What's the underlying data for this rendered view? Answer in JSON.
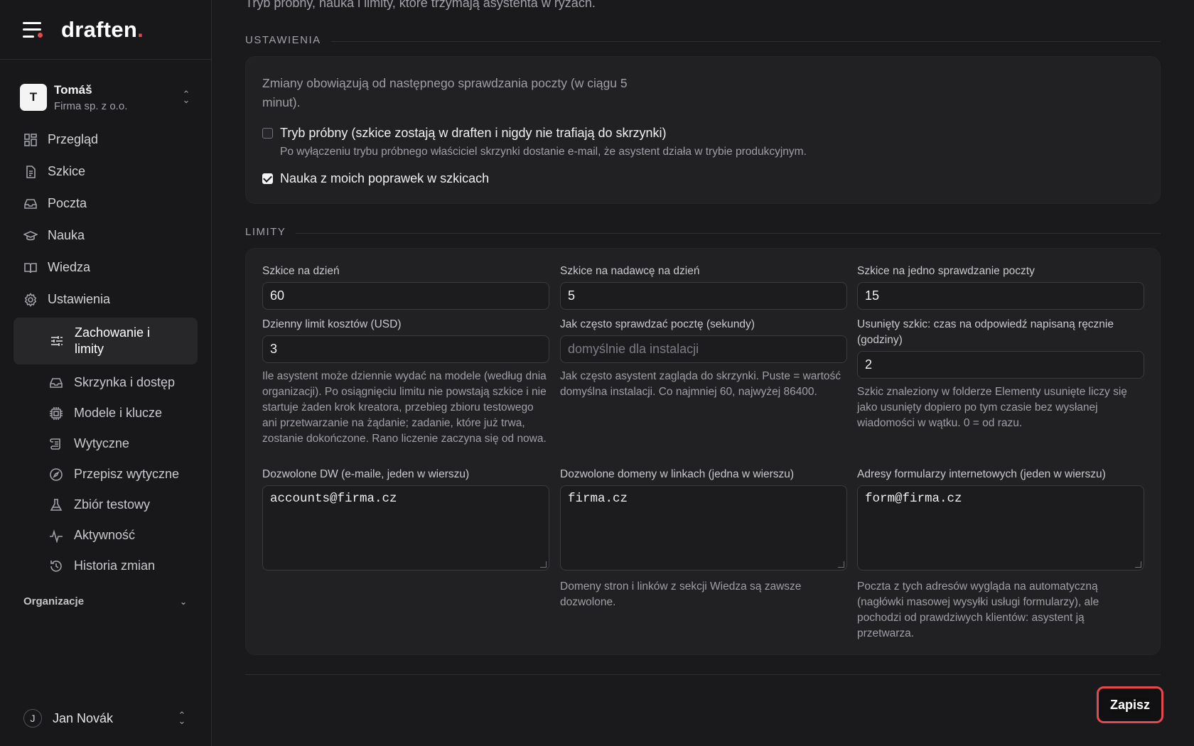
{
  "brand": {
    "logo": "draften",
    "logo_dot": "."
  },
  "org_switcher": {
    "initial": "T",
    "name": "Tomáš",
    "company": "Firma sp. z o.o."
  },
  "nav": [
    {
      "label": "Przegląd",
      "icon": "grid-icon"
    },
    {
      "label": "Szkice",
      "icon": "document-icon"
    },
    {
      "label": "Poczta",
      "icon": "inbox-icon"
    },
    {
      "label": "Nauka",
      "icon": "graduation-cap-icon"
    },
    {
      "label": "Wiedza",
      "icon": "book-icon"
    },
    {
      "label": "Ustawienia",
      "icon": "gear-icon"
    }
  ],
  "sub_nav": [
    {
      "label": "Zachowanie i limity",
      "icon": "sliders-icon",
      "active": true
    },
    {
      "label": "Skrzynka i dostęp",
      "icon": "inbox-icon"
    },
    {
      "label": "Modele i klucze",
      "icon": "chip-icon"
    },
    {
      "label": "Wytyczne",
      "icon": "scroll-icon"
    },
    {
      "label": "Przepisz wytyczne",
      "icon": "compass-icon"
    },
    {
      "label": "Zbiór testowy",
      "icon": "flask-icon"
    },
    {
      "label": "Aktywność",
      "icon": "activity-icon"
    },
    {
      "label": "Historia zmian",
      "icon": "history-icon"
    }
  ],
  "org_section": {
    "label": "Organizacje"
  },
  "user": {
    "initial": "J",
    "name": "Jan Novák"
  },
  "main": {
    "intro": "Tryb próbny, nauka i limity, które trzymają asystenta w ryzach.",
    "settings_title": "USTAWIENIA",
    "settings_note": "Zmiany obowiązują od następnego sprawdzania poczty (w ciągu 5 minut).",
    "dry_run": {
      "label": "Tryb próbny (szkice zostają w draften i nigdy nie trafiają do skrzynki)",
      "help": "Po wyłączeniu trybu próbnego właściciel skrzynki dostanie e-mail, że asystent działa w trybie produkcyjnym.",
      "checked": false
    },
    "learn": {
      "label": "Nauka z moich poprawek w szkicach",
      "checked": true
    },
    "limits_title": "LIMITY",
    "fields": {
      "drafts_per_day": {
        "label": "Szkice na dzień",
        "value": "60"
      },
      "drafts_per_sender": {
        "label": "Szkice na nadawcę na dzień",
        "value": "5"
      },
      "drafts_per_check": {
        "label": "Szkice na jedno sprawdzanie poczty",
        "value": "15"
      },
      "daily_cost": {
        "label": "Dzienny limit kosztów (USD)",
        "value": "3",
        "help": "Ile asystent może dziennie wydać na modele (według dnia organizacji). Po osiągnięciu limitu nie powstają szkice i nie startuje żaden krok kreatora, przebieg zbioru testowego ani przetwarzanie na żądanie; zadanie, które już trwa, zostanie dokończone. Rano liczenie zaczyna się od nowa."
      },
      "poll_interval": {
        "label": "Jak często sprawdzać pocztę (sekundy)",
        "placeholder": "domyślnie dla instalacji",
        "help": "Jak często asystent zagląda do skrzynki. Puste = wartość domyślna instalacji. Co najmniej 60, najwyżej 86400."
      },
      "deleted_draft": {
        "label": "Usunięty szkic: czas na odpowiedź napisaną ręcznie (godziny)",
        "value": "2",
        "help": "Szkic znaleziony w folderze Elementy usunięte liczy się jako usunięty dopiero po tym czasie bez wysłanej wiadomości w wątku. 0 = od razu."
      },
      "allowed_cc": {
        "label": "Dozwolone DW (e-maile, jeden w wierszu)",
        "value": "accounts@firma.cz"
      },
      "allowed_domains": {
        "label": "Dozwolone domeny w linkach (jedna w wierszu)",
        "value": "firma.cz",
        "help": "Domeny stron i linków z sekcji Wiedza są zawsze dozwolone."
      },
      "form_addresses": {
        "label": "Adresy formularzy internetowych (jeden w wierszu)",
        "value": "form@firma.cz",
        "help": "Poczta z tych adresów wygląda na automatyczną (nagłówki masowej wysyłki usługi formularzy), ale pochodzi od prawdziwych klientów: asystent ją przetwarza."
      }
    },
    "save_label": "Zapisz"
  }
}
